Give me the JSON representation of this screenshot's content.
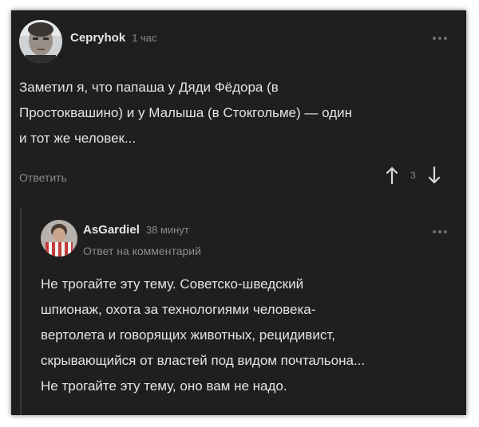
{
  "comment": {
    "username": "Cepryhok",
    "time": "1 час",
    "text": "Заметил я, что папаша у Дяди Фёдора (в\nПростоквашино) и у Малыша (в Стокгольме) — один\nи тот же человек...",
    "reply_label": "Ответить",
    "score": "3"
  },
  "reply": {
    "username": "AsGardiel",
    "time": "38 минут",
    "subtitle": "Ответ на комментарий",
    "text": "Не трогайте эту тему. Советско-шведский\nшпионаж, охота за технологиями человека-\nвертолета и говорящих животных, рецидивист,\nскрывающийся от властей под видом почтальона...\nНе трогайте эту тему, оно вам не надо."
  },
  "colors": {
    "background": "#1f1f1f",
    "text": "#e4e4e4",
    "muted": "#8b8b8b"
  }
}
